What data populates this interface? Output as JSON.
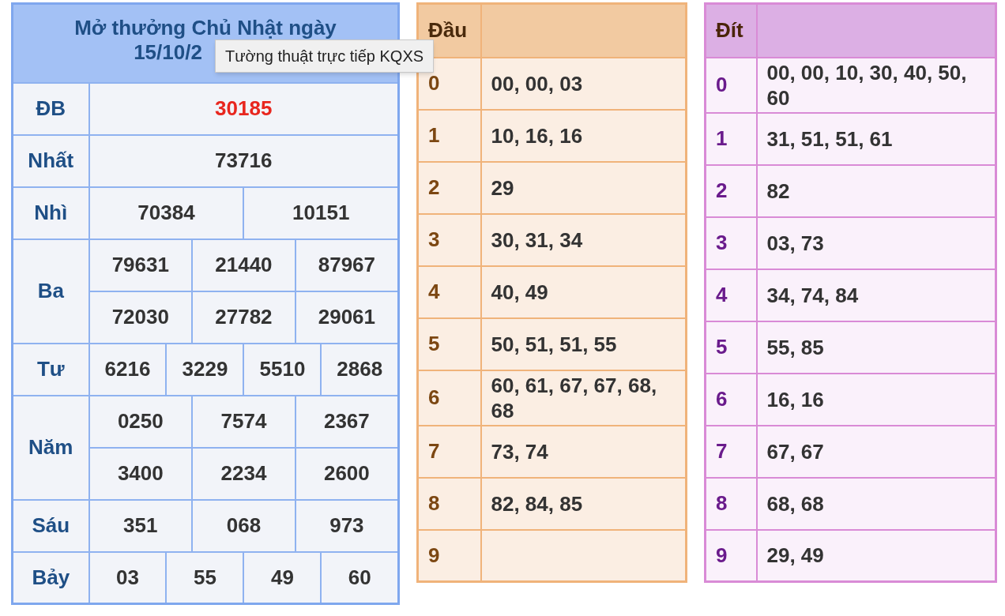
{
  "title_lines": [
    "Mở thưởng Chủ Nhật ngày",
    "15/10/2"
  ],
  "tooltip": "Tường thuật trực tiếp KQXS",
  "prizes": [
    {
      "label": "ĐB",
      "kind": "special",
      "numbers": [
        [
          "30185"
        ]
      ]
    },
    {
      "label": "Nhất",
      "kind": "normal",
      "numbers": [
        [
          "73716"
        ]
      ]
    },
    {
      "label": "Nhì",
      "kind": "normal",
      "numbers": [
        [
          "70384",
          "10151"
        ]
      ]
    },
    {
      "label": "Ba",
      "kind": "normal",
      "numbers": [
        [
          "79631",
          "21440",
          "87967"
        ],
        [
          "72030",
          "27782",
          "29061"
        ]
      ]
    },
    {
      "label": "Tư",
      "kind": "normal",
      "numbers": [
        [
          "6216",
          "3229",
          "5510",
          "2868"
        ]
      ]
    },
    {
      "label": "Năm",
      "kind": "normal",
      "numbers": [
        [
          "0250",
          "7574",
          "2367"
        ],
        [
          "3400",
          "2234",
          "2600"
        ]
      ]
    },
    {
      "label": "Sáu",
      "kind": "normal",
      "numbers": [
        [
          "351",
          "068",
          "973"
        ]
      ]
    },
    {
      "label": "Bảy",
      "kind": "normal",
      "numbers": [
        [
          "03",
          "55",
          "49",
          "60"
        ]
      ]
    }
  ],
  "dau": {
    "header": "Đầu",
    "rows": [
      {
        "digit": "0",
        "values": "00, 00, 03"
      },
      {
        "digit": "1",
        "values": "10, 16, 16"
      },
      {
        "digit": "2",
        "values": "29"
      },
      {
        "digit": "3",
        "values": "30, 31, 34"
      },
      {
        "digit": "4",
        "values": "40, 49"
      },
      {
        "digit": "5",
        "values": "50, 51, 51, 55"
      },
      {
        "digit": "6",
        "values": "60, 61, 67, 67, 68, 68"
      },
      {
        "digit": "7",
        "values": "73, 74"
      },
      {
        "digit": "8",
        "values": "82, 84, 85"
      },
      {
        "digit": "9"
      }
    ]
  },
  "dit": {
    "header": "Đít",
    "rows": [
      {
        "digit": "0",
        "values": "00, 00, 10, 30, 40, 50, 60"
      },
      {
        "digit": "1",
        "values": "31, 51, 51, 61"
      },
      {
        "digit": "2",
        "values": "82"
      },
      {
        "digit": "3",
        "values": "03, 73"
      },
      {
        "digit": "4",
        "values": "34, 74, 84"
      },
      {
        "digit": "5",
        "values": "55, 85"
      },
      {
        "digit": "6",
        "values": "16, 16"
      },
      {
        "digit": "7",
        "values": "67, 67"
      },
      {
        "digit": "8",
        "values": "68, 68"
      },
      {
        "digit": "9",
        "values": "29, 49"
      }
    ]
  }
}
